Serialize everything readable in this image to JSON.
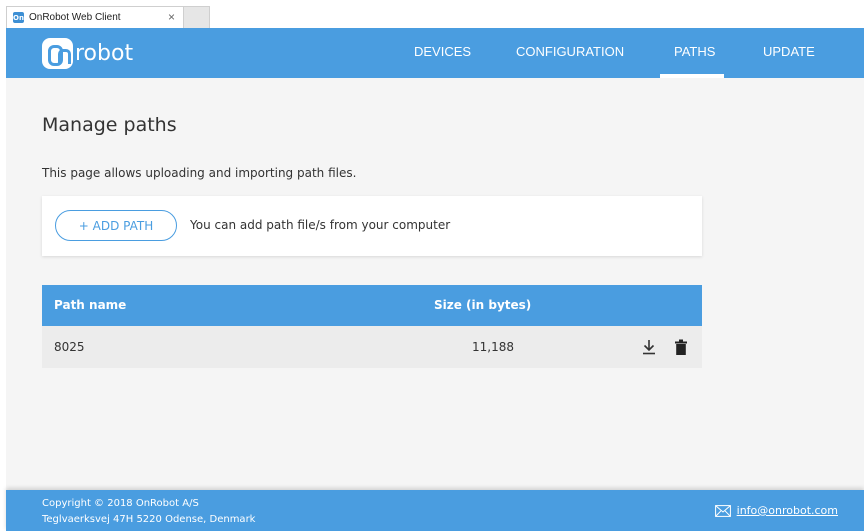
{
  "browser": {
    "tab_title": "OnRobot Web Client",
    "tab_close": "×",
    "tab_icon": "On"
  },
  "header": {
    "logo_text": "robot",
    "nav": [
      {
        "label": "DEVICES",
        "active": false
      },
      {
        "label": "CONFIGURATION",
        "active": false
      },
      {
        "label": "PATHS",
        "active": true
      },
      {
        "label": "UPDATE",
        "active": false
      }
    ]
  },
  "main": {
    "title": "Manage paths",
    "description": "This page allows uploading and importing path files.",
    "add_button_label": "+ ADD PATH",
    "add_hint": "You can add path file/s from your computer"
  },
  "table": {
    "columns": [
      "Path name",
      "Size (in bytes)"
    ],
    "rows": [
      {
        "name": "8025",
        "size": "11,188"
      }
    ]
  },
  "footer": {
    "copyright": "Copyright © 2018 OnRobot A/S",
    "address": "Teglvaerksvej 47H 5220 Odense, Denmark",
    "email": "info@onrobot.com"
  },
  "colors": {
    "brand_blue": "#4a9de0",
    "background": "#f5f5f5"
  }
}
